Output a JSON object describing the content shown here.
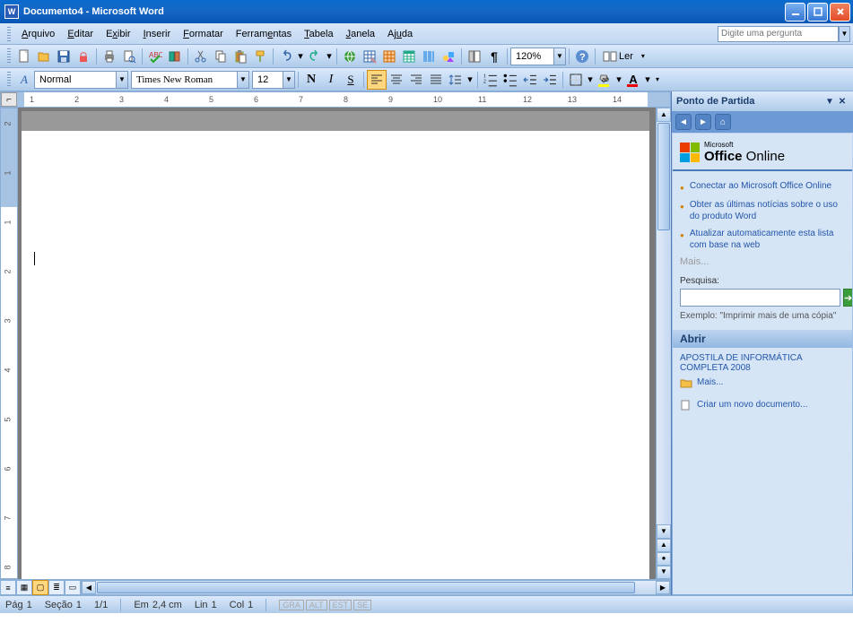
{
  "title": "Documento4 - Microsoft Word",
  "menus": [
    {
      "label": "Arquivo",
      "u": 0
    },
    {
      "label": "Editar",
      "u": 0
    },
    {
      "label": "Exibir",
      "u": 1
    },
    {
      "label": "Inserir",
      "u": 0
    },
    {
      "label": "Formatar",
      "u": 0
    },
    {
      "label": "Ferramentas",
      "u": 6
    },
    {
      "label": "Tabela",
      "u": 0
    },
    {
      "label": "Janela",
      "u": 0
    },
    {
      "label": "Ajuda",
      "u": 2
    }
  ],
  "help_placeholder": "Digite uma pergunta",
  "std_toolbar": {
    "zoom": "120%",
    "read_label": "Ler"
  },
  "fmt_toolbar": {
    "style": "Normal",
    "font": "Times New Roman",
    "size": "12"
  },
  "ruler_h": [
    "1",
    "2",
    "3",
    "4",
    "5",
    "6",
    "7",
    "8",
    "9",
    "10",
    "11",
    "12",
    "13",
    "14"
  ],
  "ruler_v": [
    "2",
    "1",
    "1",
    "2",
    "3",
    "4",
    "5",
    "6",
    "7",
    "8"
  ],
  "taskpane": {
    "title": "Ponto de Partida",
    "logo_ms": "Microsoft",
    "logo_office": "Office",
    "logo_online": " Online",
    "links": [
      "Conectar ao Microsoft Office Online",
      "Obter as últimas notícias sobre o uso do produto Word",
      "Atualizar automaticamente esta lista com base na web"
    ],
    "more": "Mais...",
    "search_label": "Pesquisa:",
    "example": "Exemplo:  \"Imprimir mais de uma cópia\"",
    "open_header": "Abrir",
    "recent_doc": "APOSTILA  DE INFORMÁTICA COMPLETA 2008",
    "more2": "Mais...",
    "new_doc": "Criar um novo documento..."
  },
  "status": {
    "page_lbl": "Pág",
    "page": "1",
    "sec_lbl": "Seção",
    "sec": "1",
    "pages": "1/1",
    "at_lbl": "Em",
    "at": "2,4 cm",
    "ln_lbl": "Lin",
    "ln": "1",
    "col_lbl": "Col",
    "col": "1",
    "modes": [
      "GRA",
      "ALT",
      "EST",
      "SE"
    ]
  }
}
